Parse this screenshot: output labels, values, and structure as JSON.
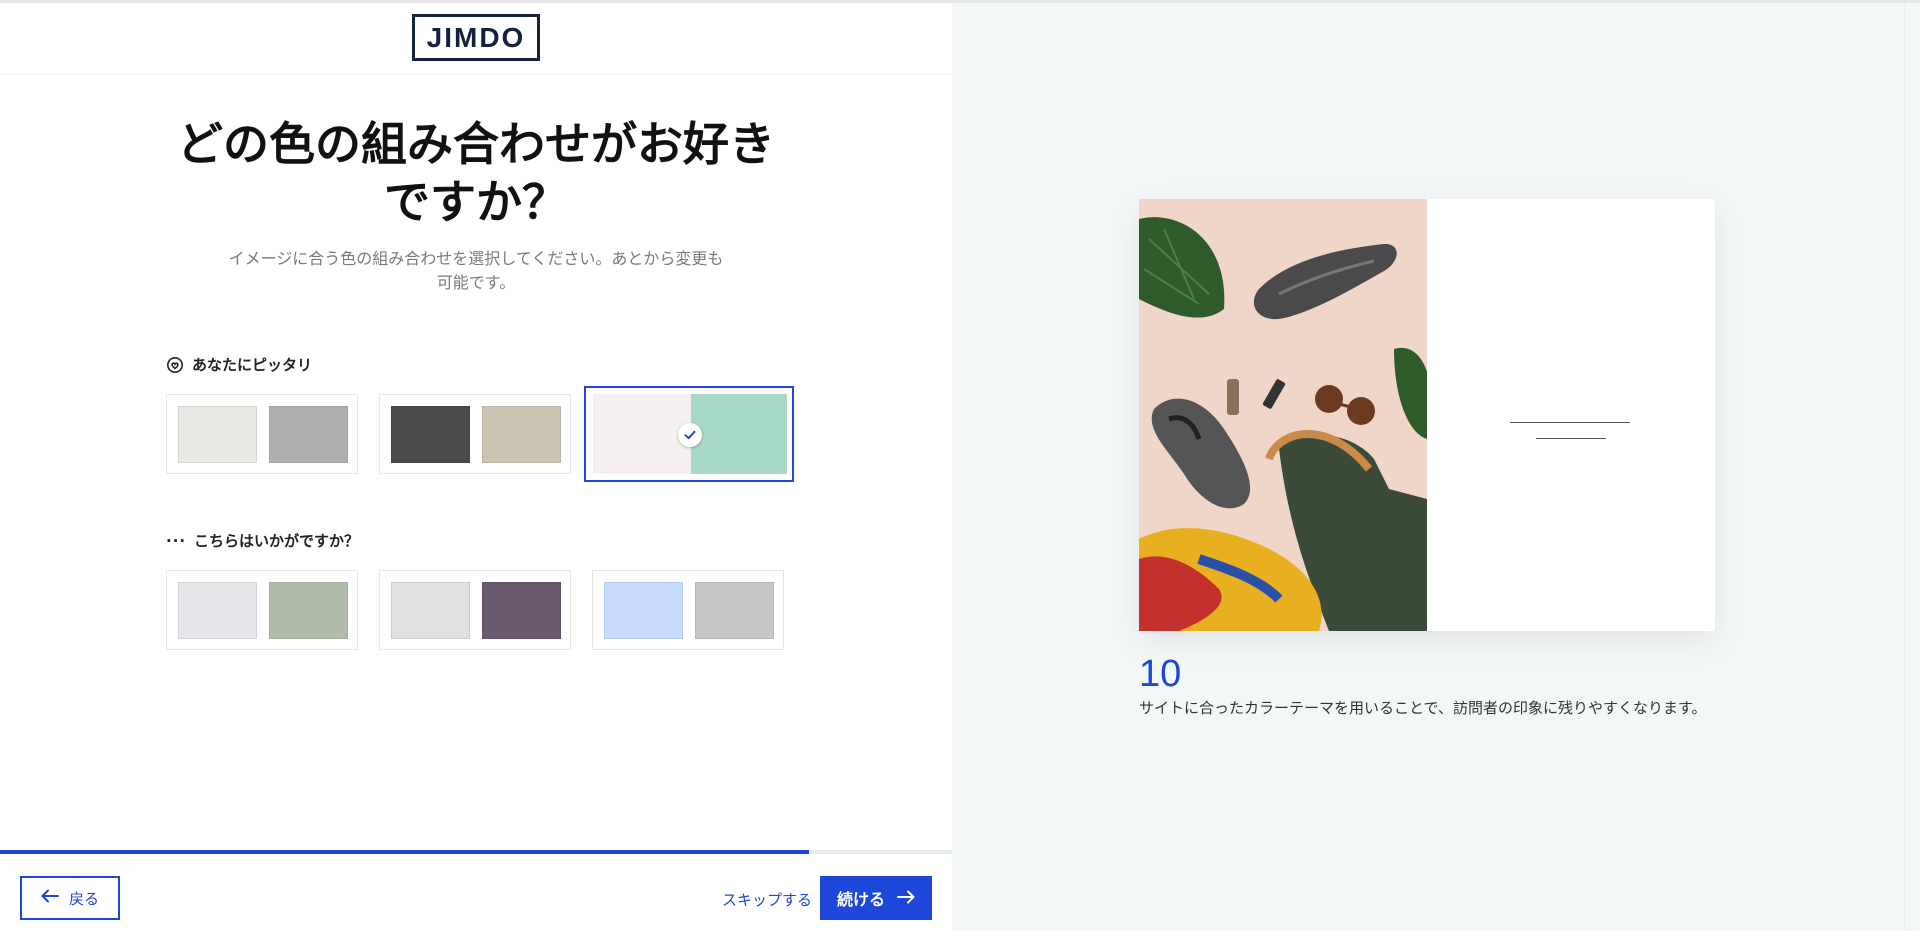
{
  "app": {
    "logo_text": "JIMDO"
  },
  "main": {
    "title": "どの色の組み合わせがお好きですか？",
    "subtitle": "イメージに合う色の組み合わせを選択してください。あとから変更も可能です。"
  },
  "sections": {
    "best_fit": {
      "label": "あなたにピッタリ",
      "icon": "heart-face-icon",
      "palettes": [
        {
          "color1": "#e8e8e4",
          "color2": "#b0b0b0",
          "selected": false
        },
        {
          "color1": "#4a4a4a",
          "color2": "#ccc4b2",
          "selected": false
        },
        {
          "color1": "#f5f0ef",
          "color2": "#a8d8c6",
          "selected": true
        }
      ]
    },
    "alternatives": {
      "label": "こちらはいかがですか？",
      "icon": "ellipsis-icon",
      "dots": "···",
      "palettes": [
        {
          "color1": "#e6e6ea",
          "color2": "#b2bcaa",
          "selected": false
        },
        {
          "color1": "#e0e0e0",
          "color2": "#6a5a70",
          "selected": false
        },
        {
          "color1": "#c8dcff",
          "color2": "#c6c6c6",
          "selected": false
        }
      ]
    }
  },
  "progress": {
    "fraction": 0.85
  },
  "footer": {
    "back_label": "戻る",
    "skip_label": "スキップする",
    "next_label": "続ける"
  },
  "tip": {
    "number": "10",
    "text": "サイトに合ったカラーテーマを用いることで、訪問者の印象に残りやすくなります。"
  },
  "colors": {
    "accent": "#1c47d8",
    "right_panel_bg": "#f4f7f8",
    "logo": "#16213e"
  }
}
